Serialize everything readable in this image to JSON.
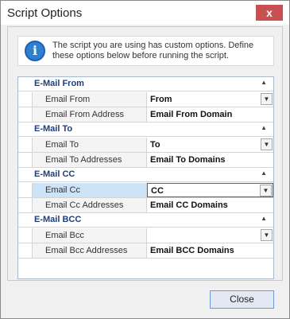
{
  "window": {
    "title": "Script Options",
    "close_glyph": "x"
  },
  "info": {
    "icon": "info-icon",
    "text": "The script you are using has custom options. Define these options below before running the script."
  },
  "grid": {
    "categories": [
      {
        "label": "E-Mail From",
        "rows": [
          {
            "name": "Email From",
            "value": "From",
            "dropdown": true
          },
          {
            "name": "Email From Address",
            "value": "Email From Domain",
            "dropdown": false
          }
        ]
      },
      {
        "label": "E-Mail To",
        "rows": [
          {
            "name": "Email To",
            "value": "To",
            "dropdown": true
          },
          {
            "name": "Email To Addresses",
            "value": "Email To Domains",
            "dropdown": false
          }
        ]
      },
      {
        "label": "E-Mail CC",
        "rows": [
          {
            "name": "Email Cc",
            "value": "CC",
            "dropdown": true,
            "selected": true
          },
          {
            "name": "Email Cc Addresses",
            "value": "Email CC Domains",
            "dropdown": false
          }
        ]
      },
      {
        "label": "E-Mail BCC",
        "rows": [
          {
            "name": "Email Bcc",
            "value": "",
            "dropdown": true
          },
          {
            "name": "Email Bcc Addresses",
            "value": "Email BCC Domains",
            "dropdown": false
          }
        ]
      }
    ],
    "collapse_glyph": "▲",
    "dropdown_glyph": "▼"
  },
  "footer": {
    "close_label": "Close"
  }
}
